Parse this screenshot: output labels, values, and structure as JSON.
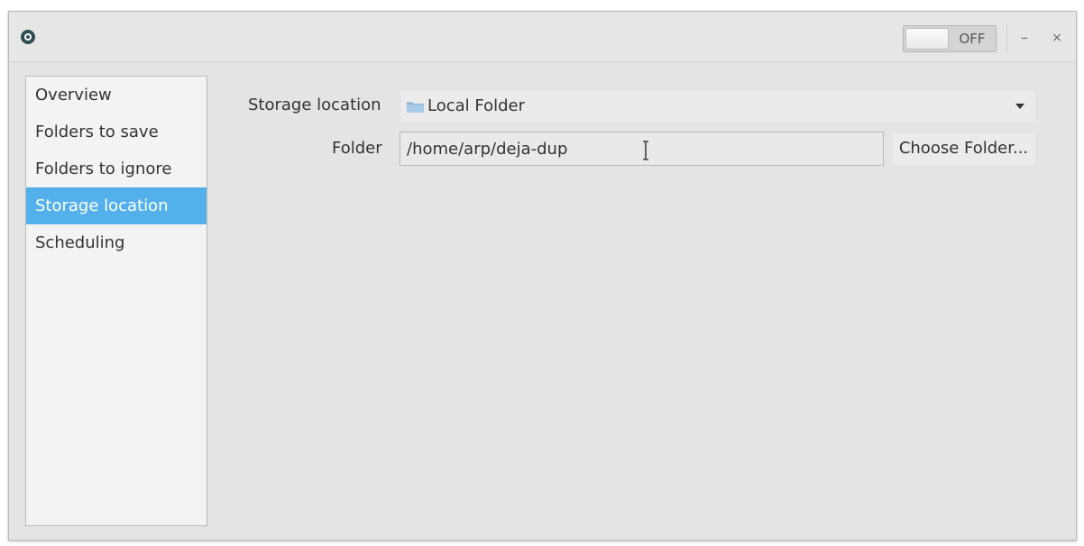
{
  "titlebar": {
    "toggle_state": "OFF",
    "minimize_glyph": "–",
    "close_glyph": "×",
    "app_icon": "app-logo-icon"
  },
  "sidebar": {
    "items": [
      {
        "label": "Overview",
        "selected": false
      },
      {
        "label": "Folders to save",
        "selected": false
      },
      {
        "label": "Folders to ignore",
        "selected": false
      },
      {
        "label": "Storage location",
        "selected": true
      },
      {
        "label": "Scheduling",
        "selected": false
      }
    ]
  },
  "main": {
    "storage_label": "Storage location",
    "storage_value": "Local Folder",
    "storage_icon": "folder-icon",
    "folder_label": "Folder",
    "folder_value": "/home/arp/deja-dup",
    "choose_button": "Choose Folder..."
  },
  "colors": {
    "selection": "#54b0ea",
    "window_bg": "#e4e4e4",
    "sidebar_bg": "#f3f3f3",
    "folder_icon": "#8ab4d9"
  }
}
